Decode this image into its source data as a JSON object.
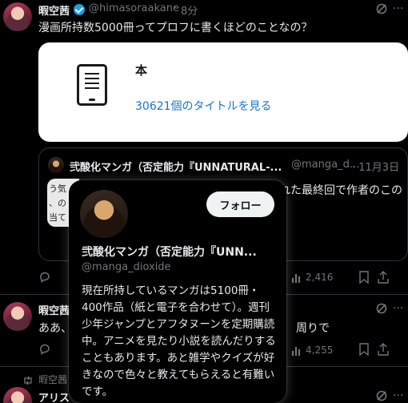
{
  "tweet1": {
    "name": "暇空茜",
    "handle": "@himasoraakane",
    "time": "8分",
    "text": "漫画所持数5000冊ってプロフに書くほどのことなの？"
  },
  "book_card": {
    "title": "本",
    "link": "30621個のタイトルを見る"
  },
  "quote": {
    "name": "弐酸化マンガ（否定能力『UNNATURAL-...",
    "handle": "@manga_d...",
    "date": "· 11月3日",
    "text_fragment": "れた最終回で作者のこの",
    "thumb_lines": [
      "う気",
      "、の",
      "当て"
    ]
  },
  "popover": {
    "follow_label": "フォロー",
    "name": "弐酸化マンガ（否定能力『UNN...",
    "handle": "@manga_dioxide",
    "bio": "現在所持しているマンガは5100冊・400作品（紙と電子を合わせて）。週刊少年ジャンプとアフタヌーンを定期購読中。アニメを見たり小説を読んだりすることもあります。あと雑学やクイズが好きなので色々と教えてもらえると有難いです。"
  },
  "tweet1_actions": {
    "views": "2,416"
  },
  "tweet2": {
    "name": "暇空茜",
    "text": "ああ、",
    "text_right": "周りで",
    "views": "4,255"
  },
  "tweet3": {
    "retweet_label": "暇空茜さ",
    "name": "アリス"
  }
}
